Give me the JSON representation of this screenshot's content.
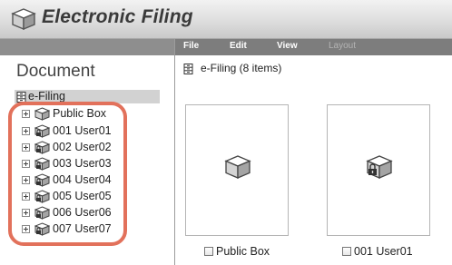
{
  "app": {
    "title": "Electronic Filing",
    "logo_icon": "box-logo-icon"
  },
  "menu": {
    "items": [
      {
        "label": "File",
        "enabled": true
      },
      {
        "label": "Edit",
        "enabled": true
      },
      {
        "label": "View",
        "enabled": true
      },
      {
        "label": "Layout",
        "enabled": false
      }
    ]
  },
  "sidebar": {
    "title": "Document",
    "root": {
      "label": "e-Filing",
      "icon": "cabinet-icon",
      "selected": true
    },
    "items": [
      {
        "label": "Public Box",
        "icon": "open-box-icon"
      },
      {
        "label": "001 User01",
        "icon": "locked-box-icon"
      },
      {
        "label": "002 User02",
        "icon": "locked-box-icon"
      },
      {
        "label": "003 User03",
        "icon": "locked-box-icon"
      },
      {
        "label": "004 User04",
        "icon": "locked-box-icon"
      },
      {
        "label": "005 User05",
        "icon": "locked-box-icon"
      },
      {
        "label": "006 User06",
        "icon": "locked-box-icon"
      },
      {
        "label": "007 User07",
        "icon": "locked-box-icon"
      }
    ]
  },
  "content": {
    "header": "e-Filing  (8 items)",
    "cards": [
      {
        "label": "Public Box",
        "icon": "open-box-icon",
        "checked": false
      },
      {
        "label": "001 User01",
        "icon": "locked-box-icon",
        "checked": false
      }
    ]
  },
  "colors": {
    "highlight": "#e2715b",
    "menubar": "#7d7d7d",
    "selected_row": "#d2d2d2"
  }
}
